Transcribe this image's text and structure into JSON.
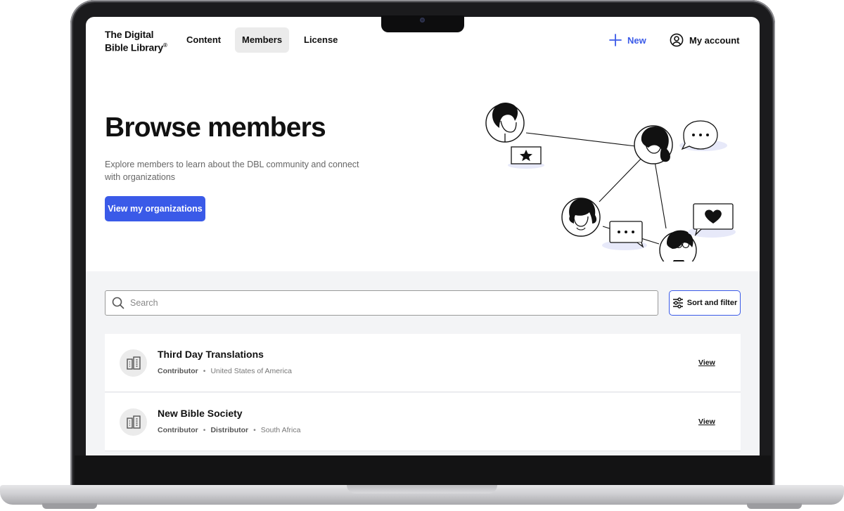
{
  "nav": {
    "logo_line1": "The Digital",
    "logo_line2": "Bible Library",
    "logo_mark": "®",
    "tabs": [
      {
        "label": "Content"
      },
      {
        "label": "Members"
      },
      {
        "label": "License"
      }
    ],
    "active_tab": "Members",
    "new_label": "New",
    "account_label": "My account"
  },
  "hero": {
    "title": "Browse members",
    "description": "Explore members to learn about the DBL community and connect with organizations",
    "cta_label": "View my organizations"
  },
  "search": {
    "placeholder": "Search",
    "value": "",
    "sort_filter_label": "Sort and filter"
  },
  "members": [
    {
      "name": "Third Day Translations",
      "roles": [
        "Contributor"
      ],
      "country": "United States of America",
      "action": "View"
    },
    {
      "name": "New Bible Society",
      "roles": [
        "Contributor",
        "Distributor"
      ],
      "country": "South Africa",
      "action": "View"
    }
  ],
  "separator": "•",
  "colors": {
    "accent": "#3a5ae8",
    "active_tab_bg": "#ebebeb",
    "list_bg": "#f3f4f6"
  },
  "icons": {
    "new": "plus-icon",
    "account": "user-circle-icon",
    "search": "search-icon",
    "sort": "sliders-icon",
    "member": "building-icon"
  }
}
